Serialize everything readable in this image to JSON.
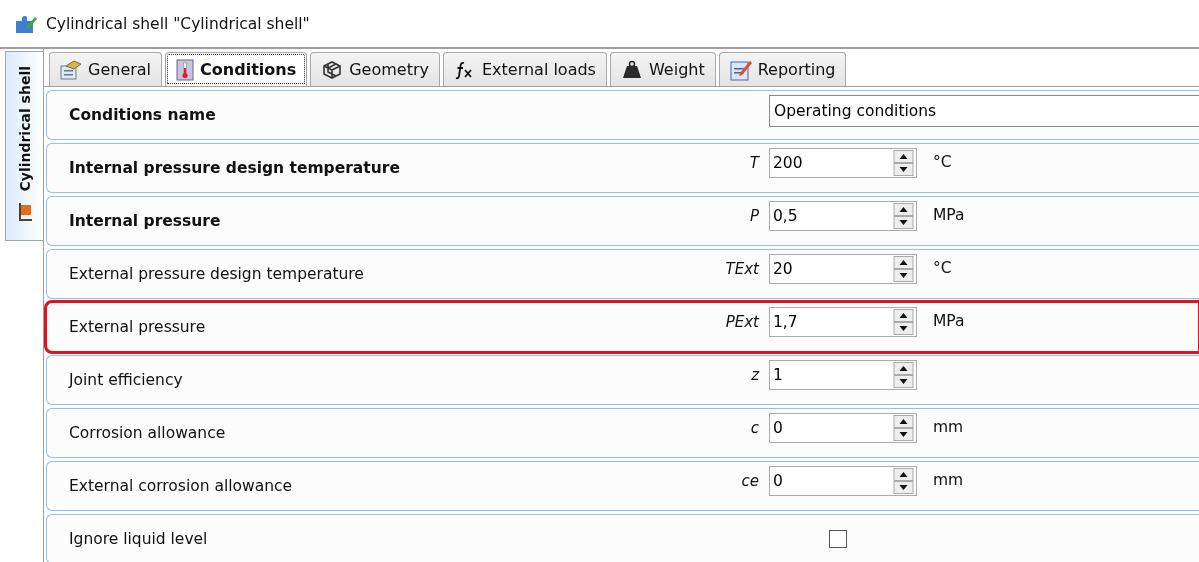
{
  "window": {
    "title": "Cylindrical shell \"Cylindrical shell\""
  },
  "side_tab": {
    "label": "Cylindrical shell"
  },
  "tabs": [
    {
      "label": "General",
      "selected": false
    },
    {
      "label": "Conditions",
      "selected": true
    },
    {
      "label": "Geometry",
      "selected": false
    },
    {
      "label": "External loads",
      "selected": false
    },
    {
      "label": "Weight",
      "selected": false
    },
    {
      "label": "Reporting",
      "selected": false
    }
  ],
  "rows": [
    {
      "kind": "text",
      "label": "Conditions name",
      "bold": true,
      "highlighted": false,
      "value": "Operating conditions"
    },
    {
      "kind": "spin",
      "label": "Internal pressure design temperature",
      "bold": true,
      "highlighted": false,
      "symbol": "T",
      "value": "200",
      "unit": "°C"
    },
    {
      "kind": "spin",
      "label": "Internal pressure",
      "bold": true,
      "highlighted": false,
      "symbol": "P",
      "value": "0,5",
      "unit": "MPa"
    },
    {
      "kind": "spin",
      "label": "External pressure design temperature",
      "bold": false,
      "highlighted": false,
      "symbol": "TExt",
      "value": "20",
      "unit": "°C"
    },
    {
      "kind": "spin",
      "label": "External pressure",
      "bold": false,
      "highlighted": true,
      "symbol": "PExt",
      "value": "1,7",
      "unit": "MPa"
    },
    {
      "kind": "spin",
      "label": "Joint efficiency",
      "bold": false,
      "highlighted": false,
      "symbol": "z",
      "value": "1"
    },
    {
      "kind": "spin",
      "label": "Corrosion allowance",
      "bold": false,
      "highlighted": false,
      "symbol": "c",
      "value": "0",
      "unit": "mm"
    },
    {
      "kind": "spin",
      "label": "External corrosion allowance",
      "bold": false,
      "highlighted": false,
      "symbol": "ce",
      "value": "0",
      "unit": "mm"
    },
    {
      "kind": "checkbox",
      "label": "Ignore liquid level",
      "bold": false,
      "highlighted": false,
      "checked": false
    }
  ]
}
